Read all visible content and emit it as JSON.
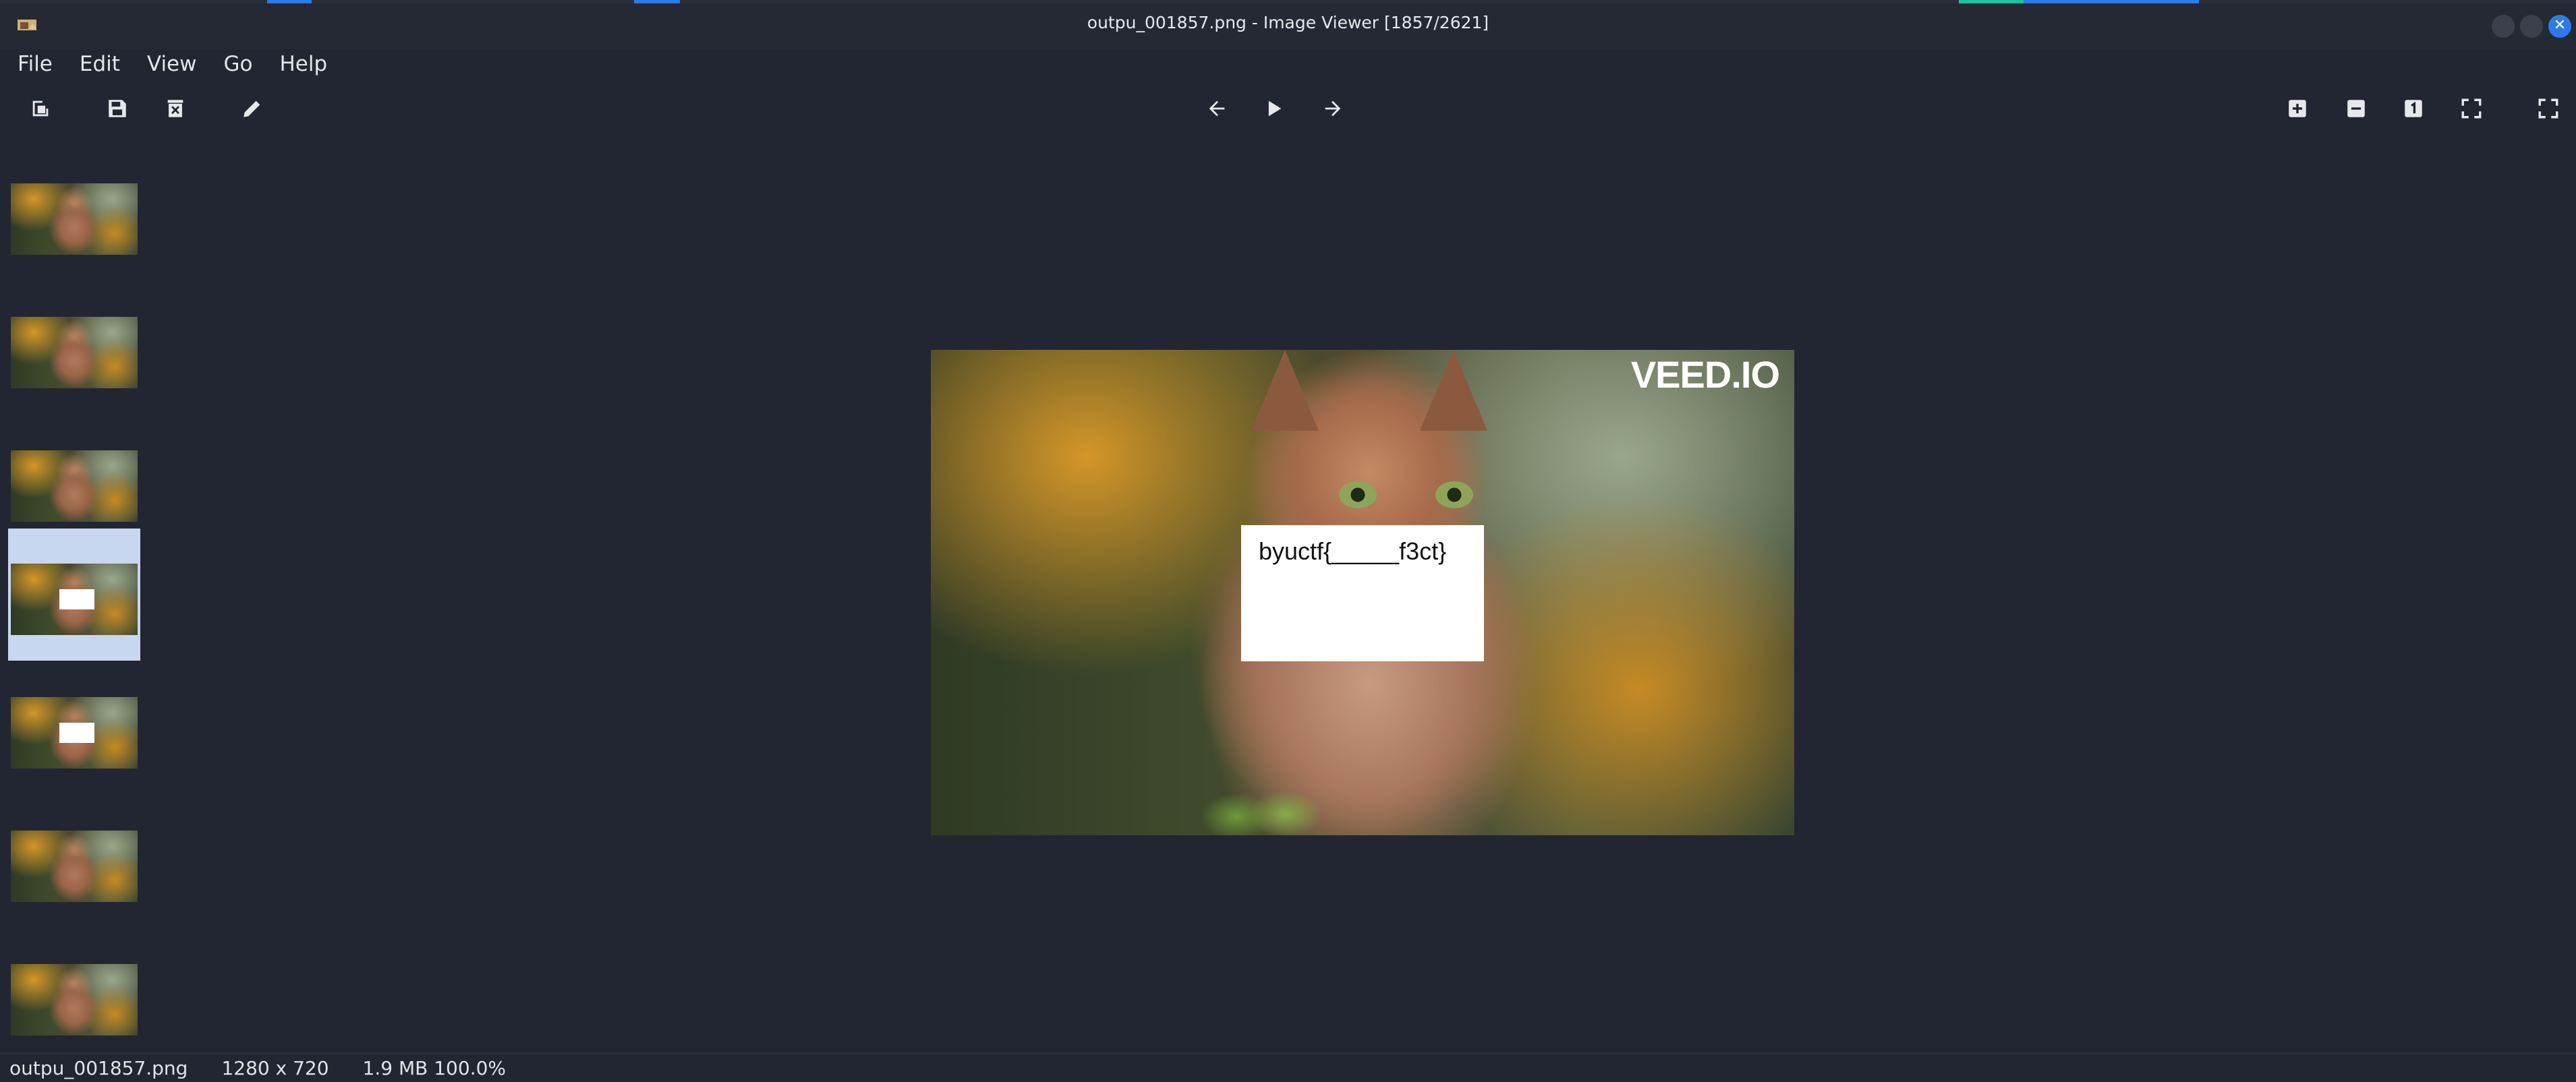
{
  "window": {
    "title": "outpu_001857.png - Image Viewer [1857/2621]",
    "accent_color": "#2d7be8"
  },
  "menu": [
    "File",
    "Edit",
    "View",
    "Go",
    "Help"
  ],
  "toolbar": {
    "left": [
      "open-icon",
      "save-icon",
      "delete-icon",
      "edit-icon"
    ],
    "center": [
      "previous-icon",
      "slideshow-play-icon",
      "next-icon"
    ],
    "right": [
      "zoom-in-icon",
      "zoom-out-icon",
      "original-size-icon",
      "fit-window-icon",
      "fullscreen-icon"
    ]
  },
  "thumbnails": [
    {
      "has_note": false,
      "selected": false
    },
    {
      "has_note": false,
      "selected": false
    },
    {
      "has_note": false,
      "selected": false
    },
    {
      "has_note": true,
      "selected": true
    },
    {
      "has_note": true,
      "selected": false
    },
    {
      "has_note": false,
      "selected": false
    },
    {
      "has_note": false,
      "selected": false
    }
  ],
  "image": {
    "watermark": "VEED.IO",
    "overlay_text": "byuctf{_____f3ct}"
  },
  "status": {
    "filename": "outpu_001857.png",
    "dimensions": "1280 x 720",
    "size_zoom": "1.9 MB 100.0%"
  }
}
